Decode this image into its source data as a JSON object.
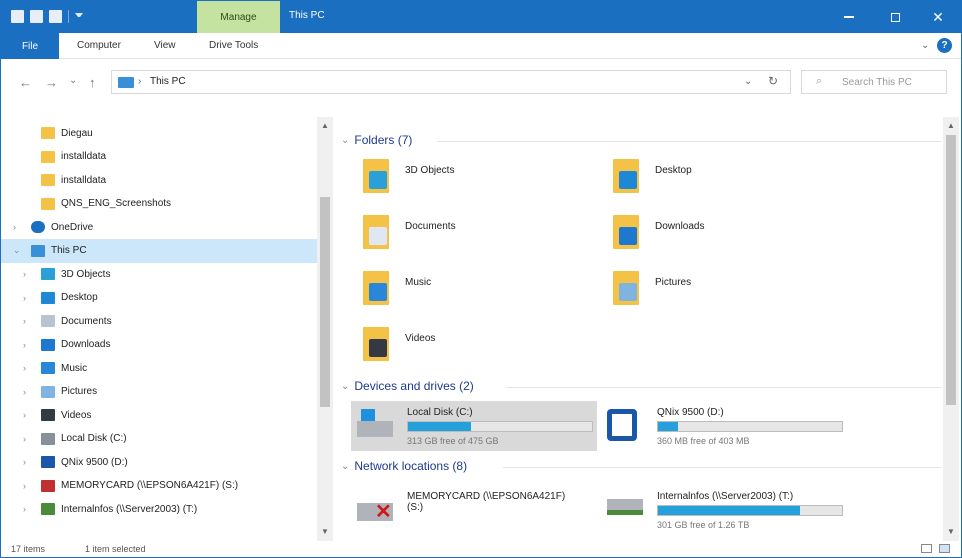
{
  "titlebar": {
    "manage_tab": "Manage",
    "title": "This PC",
    "close_glyph": "✕"
  },
  "ribbon": {
    "file": "File",
    "tabs": [
      "Computer",
      "View",
      "Drive Tools"
    ],
    "help": "?"
  },
  "address": {
    "back": "←",
    "forward": "→",
    "recent": "⌄",
    "up": "↑",
    "path": "This PC",
    "separator": "›",
    "dropdown": "⌄",
    "refresh": "↻",
    "search_icon": "⌕",
    "search_placeholder": "Search This PC"
  },
  "nav": {
    "items": [
      {
        "label": "Diegau",
        "icon": "folder-icon",
        "expander": ""
      },
      {
        "label": "installdata",
        "icon": "folder-icon",
        "expander": ""
      },
      {
        "label": "installdata",
        "icon": "folder-sync-icon",
        "expander": ""
      },
      {
        "label": "QNS_ENG_Screenshots",
        "icon": "folder-icon",
        "expander": ""
      },
      {
        "label": "OneDrive",
        "icon": "onedrive-icon",
        "expander": "›"
      },
      {
        "label": "This PC",
        "icon": "this-pc-icon",
        "expander": "⌄",
        "selected": true
      },
      {
        "label": "3D Objects",
        "icon": "3d-objects-icon",
        "expander": "›"
      },
      {
        "label": "Desktop",
        "icon": "desktop-icon",
        "expander": "›"
      },
      {
        "label": "Documents",
        "icon": "documents-icon",
        "expander": "›"
      },
      {
        "label": "Downloads",
        "icon": "downloads-icon",
        "expander": "›"
      },
      {
        "label": "Music",
        "icon": "music-icon",
        "expander": "›"
      },
      {
        "label": "Pictures",
        "icon": "pictures-icon",
        "expander": "›"
      },
      {
        "label": "Videos",
        "icon": "videos-icon",
        "expander": "›"
      },
      {
        "label": "Local Disk (C:)",
        "icon": "local-disk-icon",
        "expander": "›"
      },
      {
        "label": "QNix 9500 (D:)",
        "icon": "qnix-drive-icon",
        "expander": "›"
      },
      {
        "label": "MEMORYCARD (\\\\EPSON6A421F) (S:)",
        "icon": "network-drive-disconnected-icon",
        "expander": "›"
      },
      {
        "label": "Internalnfos (\\\\Server2003) (T:)",
        "icon": "network-drive-icon",
        "expander": "›"
      }
    ],
    "scroll_up": "▲",
    "scroll_down": "▼"
  },
  "content": {
    "groups": {
      "folders": "Folders (7)",
      "devices": "Devices and drives (2)",
      "network": "Network locations (8)"
    },
    "group_chevron": "⌄",
    "folders": [
      {
        "label": "3D Objects",
        "icon": "3d-objects-folder-icon",
        "overlay": "#2a9fd8"
      },
      {
        "label": "Desktop",
        "icon": "desktop-folder-icon",
        "overlay": "#1e88d6"
      },
      {
        "label": "Documents",
        "icon": "documents-folder-icon",
        "overlay": "#dfe8f2"
      },
      {
        "label": "Downloads",
        "icon": "downloads-folder-icon",
        "overlay": "#1e78d0"
      },
      {
        "label": "Music",
        "icon": "music-folder-icon",
        "overlay": "#2a86d8"
      },
      {
        "label": "Pictures",
        "icon": "pictures-folder-icon",
        "overlay": "#7fb4e0"
      },
      {
        "label": "Videos",
        "icon": "videos-folder-icon",
        "overlay": "#333a44"
      }
    ],
    "drives": [
      {
        "name": "Local Disk (C:)",
        "free": "313 GB free of 475 GB",
        "used_fraction": 0.34,
        "icon": "local-disk-icon",
        "selected": true
      },
      {
        "name": "QNix 9500 (D:)",
        "free": "360 MB free of 403 MB",
        "used_fraction": 0.11,
        "icon": "qnix-drive-icon"
      }
    ],
    "network": [
      {
        "name": "MEMORYCARD (\\\\EPSON6A421F)\n(S:)",
        "icon": "network-drive-disconnected-icon"
      },
      {
        "name": "Internalnfos (\\\\Server2003) (T:)",
        "free": "301 GB free of 1.26 TB",
        "used_fraction": 0.77,
        "icon": "network-drive-icon"
      }
    ],
    "scroll_up": "▲",
    "scroll_down": "▼"
  },
  "status": {
    "items": "17 items",
    "selected": "1 item selected"
  },
  "colors": {
    "accent": "#1b6fc0",
    "manage": "#c4e3a0",
    "selection": "#cce6fa",
    "drive_bar": "#26a0da",
    "folder": "#f3c246"
  }
}
